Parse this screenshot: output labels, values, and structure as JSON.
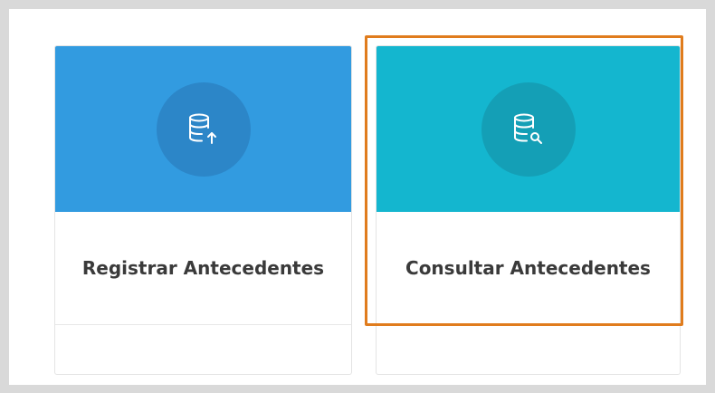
{
  "cards": [
    {
      "title": "Registrar Antecedentes",
      "icon": "database-upload-icon",
      "banner_color": "#329be0"
    },
    {
      "title": "Consultar Antecedentes",
      "icon": "database-search-icon",
      "banner_color": "#14b6cf",
      "highlighted": true
    }
  ],
  "highlight_color": "#e07c1d"
}
